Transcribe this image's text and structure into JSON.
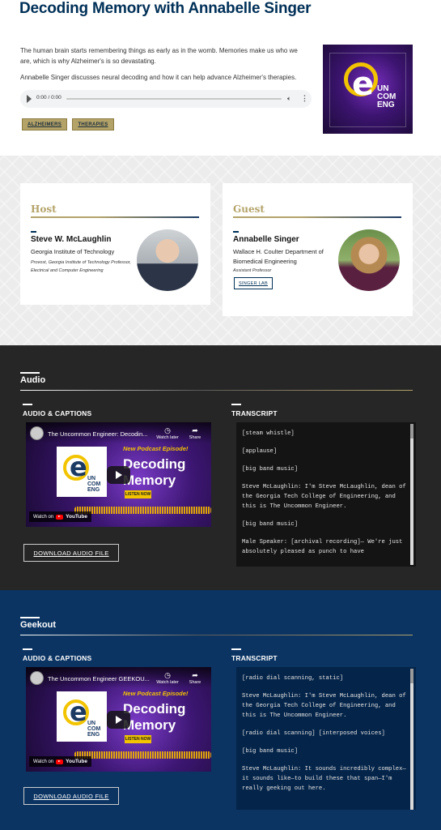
{
  "page": {
    "title": "Decoding Memory with Annabelle Singer",
    "description_1": "The human brain starts remembering things as early as in the womb. Memories make us who we are, which is why Alzheimer's is so devastating.",
    "description_2": "Annabelle Singer discusses neural decoding and how it can help advance Alzheimer's therapies."
  },
  "audio_player": {
    "time": "0:00 / 0:00"
  },
  "tags": [
    "ALZHEIMERS",
    "THERAPIES"
  ],
  "artwork": {
    "logo_letters": "UN COM ENG"
  },
  "host": {
    "heading": "Host",
    "name": "Steve W. McLaughlin",
    "org": "Georgia Institute of Technology",
    "role": "Provost, Georgia Institute of Technology Professor, Electrical and Computer Engineering"
  },
  "guest": {
    "heading": "Guest",
    "name": "Annabelle Singer",
    "org": "Wallace H. Coulter Department of Biomedical Engineering",
    "role": "Assistant Professor",
    "lab_button": "SINGER LAB"
  },
  "audio_section": {
    "title": "Audio",
    "captions_heading": "AUDIO & CAPTIONS",
    "transcript_heading": "TRANSCRIPT",
    "video_title": "The Uncommon Engineer: Decodin...",
    "download_label": "DOWNLOAD AUDIO FILE",
    "transcript": [
      "[steam whistle]",
      "[applause]",
      "[big band music]",
      "Steve McLaughlin: I'm Steve McLaughlin, dean of the Georgia Tech College of Engineering, and this is The Uncommon Engineer.",
      "[big band music]",
      "Male Speaker: [archival recording]— We're just absolutely pleased as punch to have"
    ]
  },
  "geekout_section": {
    "title": "Geekout",
    "captions_heading": "AUDIO & CAPTIONS",
    "transcript_heading": "TRANSCRIPT",
    "video_title": "The Uncommon Engineer GEEKOU...",
    "download_label": "DOWNLOAD AUDIO FILE",
    "transcript": [
      "[radio dial scanning, static]",
      "Steve McLaughlin: I'm Steve McLaughlin, dean of the Georgia Tech College of Engineering, and this is The Uncommon Engineer.",
      "[radio dial scanning] [interposed voices]",
      "[big band music]",
      "Steve McLaughlin: It sounds incredibly complex—it sounds like—to build these that span—I'm really geeking out here."
    ]
  },
  "video": {
    "watch_later": "Watch later",
    "share": "Share",
    "new_episode": "New Podcast Episode!",
    "headline": "Decoding Memory",
    "listen_now": "LISTEN NOW",
    "watch_on": "Watch on",
    "youtube": "YouTube",
    "logo_letters": "UN COM ENG"
  },
  "colors": {
    "navy": "#003057",
    "gold": "#b3a369",
    "audio_bg": "#262626",
    "geekout_bg": "#0b3463"
  }
}
